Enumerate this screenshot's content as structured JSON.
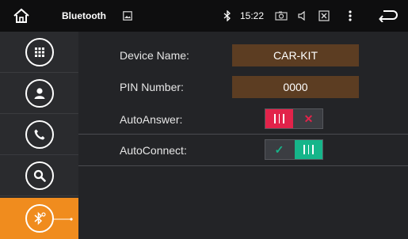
{
  "status_bar": {
    "app_title": "Bluetooth",
    "time": "15:22",
    "icons": [
      "home-icon",
      "gallery-icon",
      "bluetooth-icon",
      "camera-icon",
      "volume-icon",
      "close-box-icon",
      "more-icon",
      "back-icon"
    ]
  },
  "sidebar": {
    "items": [
      {
        "name": "apps-grid-icon"
      },
      {
        "name": "contacts-icon"
      },
      {
        "name": "phone-icon"
      },
      {
        "name": "search-icon"
      },
      {
        "name": "bluetooth-settings-icon",
        "active": true
      }
    ],
    "active_color": "#f08c1e"
  },
  "settings": {
    "device_name_label": "Device Name:",
    "device_name_value": "CAR-KIT",
    "pin_label": "PIN Number:",
    "pin_value": "0000",
    "auto_answer_label": "AutoAnswer:",
    "auto_answer_on": false,
    "auto_connect_label": "AutoConnect:",
    "auto_connect_on": true
  },
  "colors": {
    "toggle_off": "#e2234a",
    "toggle_on": "#16b58a",
    "field_bg": "#5c3d22"
  }
}
